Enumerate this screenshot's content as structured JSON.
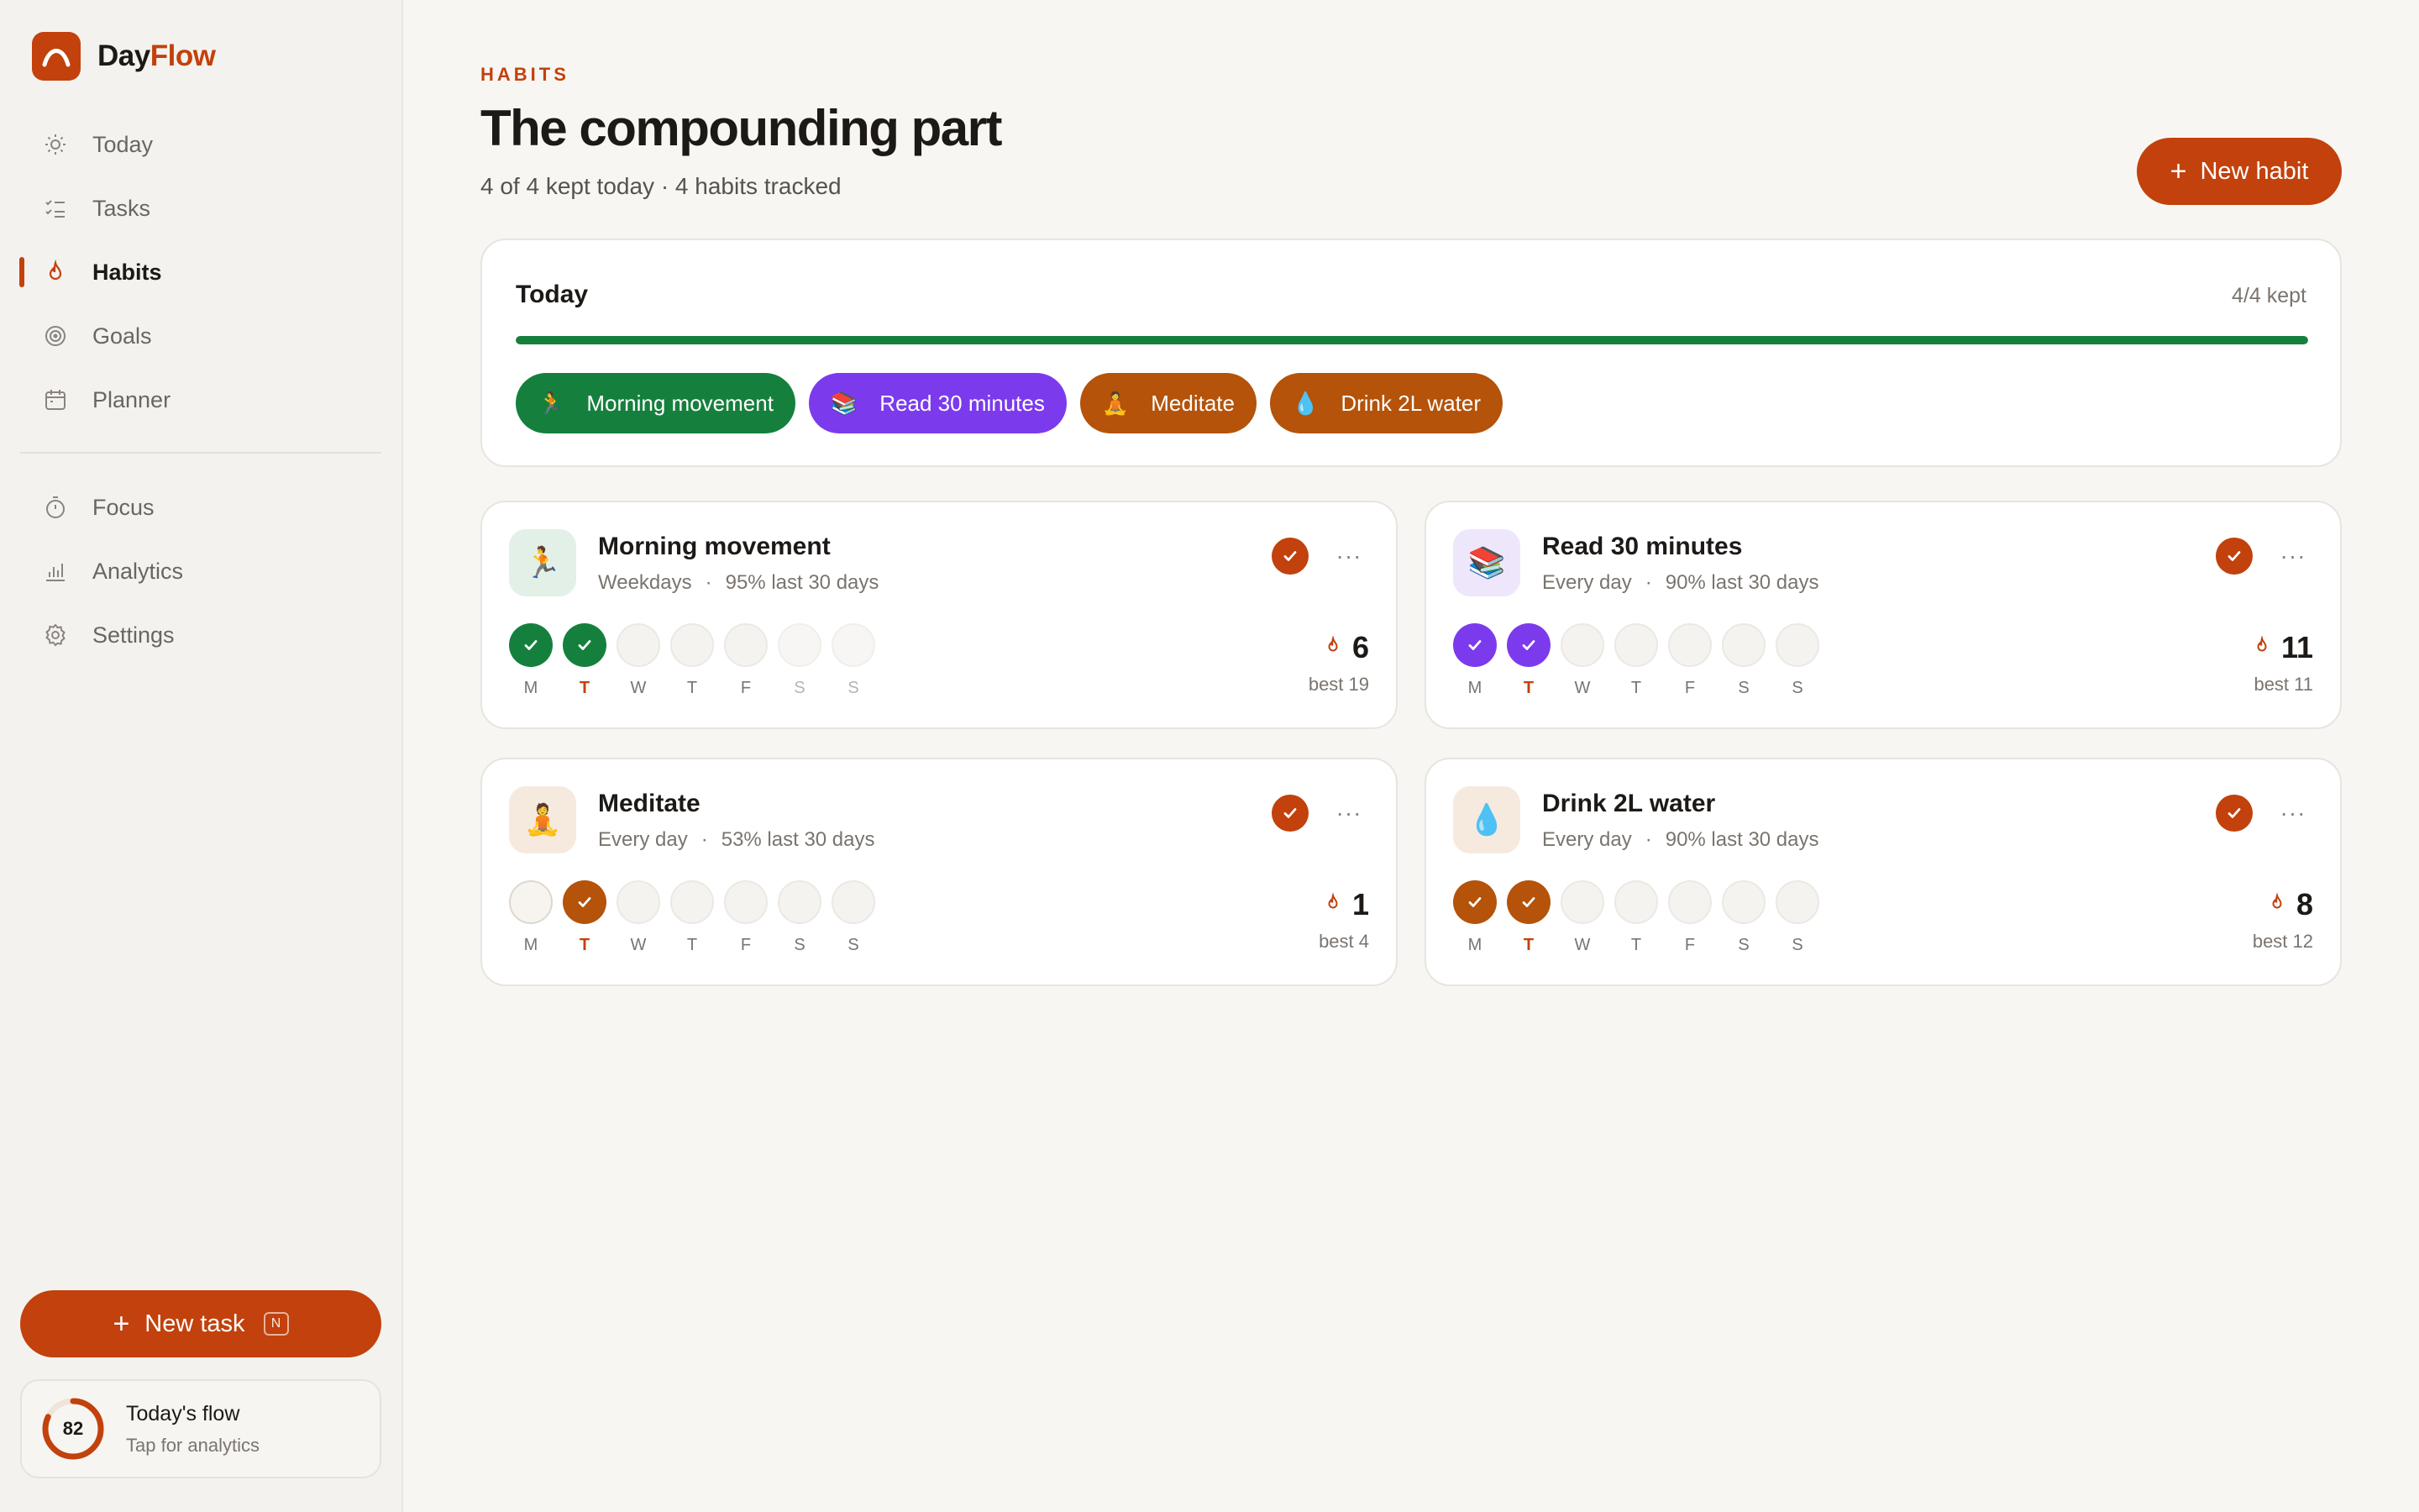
{
  "app": {
    "name_part1": "Day",
    "name_part2": "Flow"
  },
  "nav": {
    "primary": [
      {
        "label": "Today",
        "icon": "sun-icon"
      },
      {
        "label": "Tasks",
        "icon": "checklist-icon"
      },
      {
        "label": "Habits",
        "icon": "flame-icon",
        "active": true
      },
      {
        "label": "Goals",
        "icon": "target-icon"
      },
      {
        "label": "Planner",
        "icon": "calendar-icon"
      }
    ],
    "secondary": [
      {
        "label": "Focus",
        "icon": "timer-icon"
      },
      {
        "label": "Analytics",
        "icon": "bar-chart-icon"
      },
      {
        "label": "Settings",
        "icon": "gear-icon"
      }
    ]
  },
  "sidebar_actions": {
    "new_task_label": "New task",
    "new_task_shortcut": "N"
  },
  "flow": {
    "score": "82",
    "score_fraction": 0.82,
    "title": "Today's flow",
    "subtitle": "Tap for analytics"
  },
  "page": {
    "eyebrow": "HABITS",
    "title": "The compounding part",
    "subtitle": "4 of 4 kept today · 4 habits tracked",
    "new_habit_label": "New habit"
  },
  "today": {
    "title": "Today",
    "kept_label": "4/4 kept",
    "progress_fraction": 1.0,
    "chips": [
      {
        "emoji": "🏃",
        "label": "Morning movement",
        "color": "#15803D"
      },
      {
        "emoji": "📚",
        "label": "Read 30 minutes",
        "color": "#7C3AED"
      },
      {
        "emoji": "🧘",
        "label": "Meditate",
        "color": "#B45309"
      },
      {
        "emoji": "💧",
        "label": "Drink 2L water",
        "color": "#B45309"
      }
    ]
  },
  "day_labels": [
    "M",
    "T",
    "W",
    "T",
    "F",
    "S",
    "S"
  ],
  "habits": [
    {
      "name": "Morning movement",
      "emoji": "🏃",
      "schedule": "Weekdays",
      "rate": "95% last 30 days",
      "color": "#15803D",
      "icon_bg": "#E3F0E7",
      "done": [
        true,
        true,
        false,
        false,
        false,
        false,
        false
      ],
      "off_days": [
        5,
        6
      ],
      "streak": "6",
      "best": "best 19"
    },
    {
      "name": "Read 30 minutes",
      "emoji": "📚",
      "schedule": "Every day",
      "rate": "90% last 30 days",
      "color": "#7C3AED",
      "icon_bg": "#EEE6FB",
      "done": [
        true,
        true,
        false,
        false,
        false,
        false,
        false
      ],
      "off_days": [],
      "streak": "11",
      "best": "best 11"
    },
    {
      "name": "Meditate",
      "emoji": "🧘",
      "schedule": "Every day",
      "rate": "53% last 30 days",
      "color": "#B45309",
      "icon_bg": "#F6EADF",
      "done": [
        false,
        true,
        false,
        false,
        false,
        false,
        false
      ],
      "off_days": [],
      "streak": "1",
      "best": "best 4"
    },
    {
      "name": "Drink 2L water",
      "emoji": "💧",
      "schedule": "Every day",
      "rate": "90% last 30 days",
      "color": "#B45309",
      "icon_bg": "#F6EADF",
      "done": [
        true,
        true,
        false,
        false,
        false,
        false,
        false
      ],
      "off_days": [],
      "streak": "8",
      "best": "best 12"
    }
  ],
  "colors": {
    "accent": "#C2410C",
    "success": "#15803D"
  }
}
